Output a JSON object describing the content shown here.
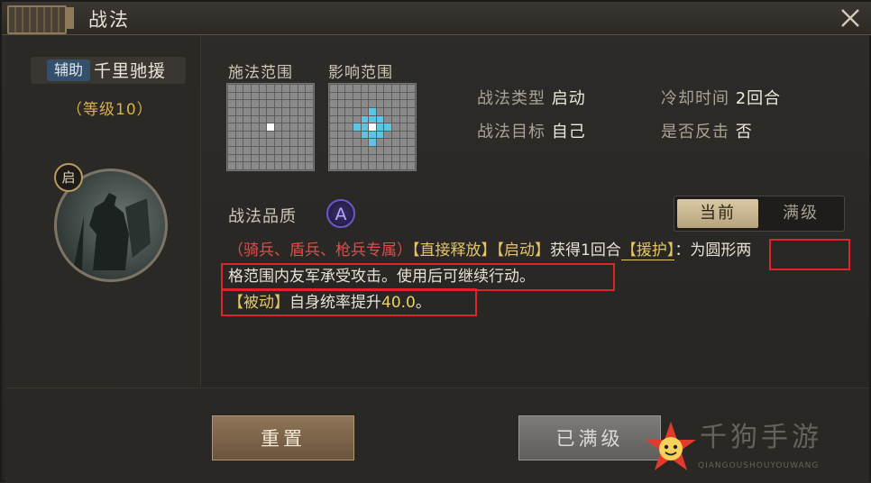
{
  "window": {
    "title": "战法"
  },
  "left": {
    "aux_badge": "辅助",
    "skill_name": "千里驰援",
    "level": "（等级10）",
    "active_tag": "启"
  },
  "range": {
    "cast_label": "施法范围",
    "effect_label": "影响范围"
  },
  "info": {
    "type_key": "战法类型",
    "type_val": "启动",
    "cd_key": "冷却时间",
    "cd_val": "2回合",
    "target_key": "战法目标",
    "target_val": "自己",
    "counter_key": "是否反击",
    "counter_val": "否"
  },
  "quality": {
    "label": "战法品质",
    "grade": "A"
  },
  "tabs": {
    "current": "当前",
    "max": "满级"
  },
  "description": {
    "restrict": "（骑兵、盾兵、枪兵专属）",
    "tag1": "【直接释放】",
    "tag2": "【启动】",
    "text1": "获得1回合",
    "tag3": "【援护】",
    "text2": "：为圆形两",
    "text3": "格范围内友军承受攻击。使用后可继续行动。",
    "passive_tag": "【被动】",
    "passive_text": "自身统率提升",
    "passive_value": "40.0",
    "passive_end": "。"
  },
  "buttons": {
    "reset": "重置",
    "maxed": "已满级"
  },
  "watermark": {
    "text": "千狗手游",
    "sub": "QIANGOUSHOUYOUWANG"
  },
  "colors": {
    "highlight_box": "#e0222a",
    "area_cell": "#5bc6e4",
    "accent_gold": "#d8b04a"
  }
}
